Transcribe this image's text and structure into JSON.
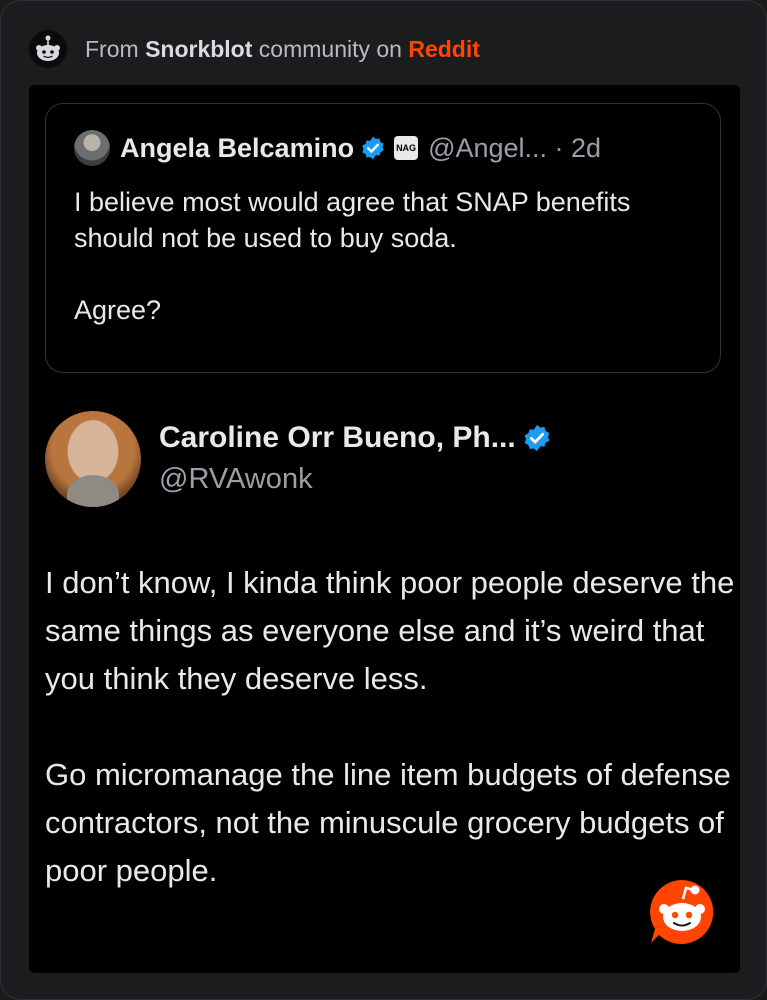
{
  "source": {
    "prefix": "From",
    "community": "Snorkblot",
    "middle": "community on",
    "platform": "Reddit",
    "icon": "reddit-snoo-icon"
  },
  "quoted_tweet": {
    "name": "Angela Belcamino",
    "org_badge": "NAG",
    "handle_time": "@Angel... · 2d",
    "paragraphs": [
      "I believe most would agree that SNAP benefits should not be used to buy soda.",
      "Agree?"
    ]
  },
  "tweet": {
    "name": "Caroline Orr Bueno, Ph...",
    "handle": "@RVAwonk",
    "paragraphs": [
      "I don’t know, I kinda think poor people deserve the same things as everyone else and it’s weird that you think they deserve less.",
      "Go micromanage the line item budgets of defense contractors, not the minuscule grocery budgets of poor people."
    ]
  },
  "colors": {
    "reddit_orange": "#ff4500",
    "verified_blue": "#1d9bf0"
  }
}
